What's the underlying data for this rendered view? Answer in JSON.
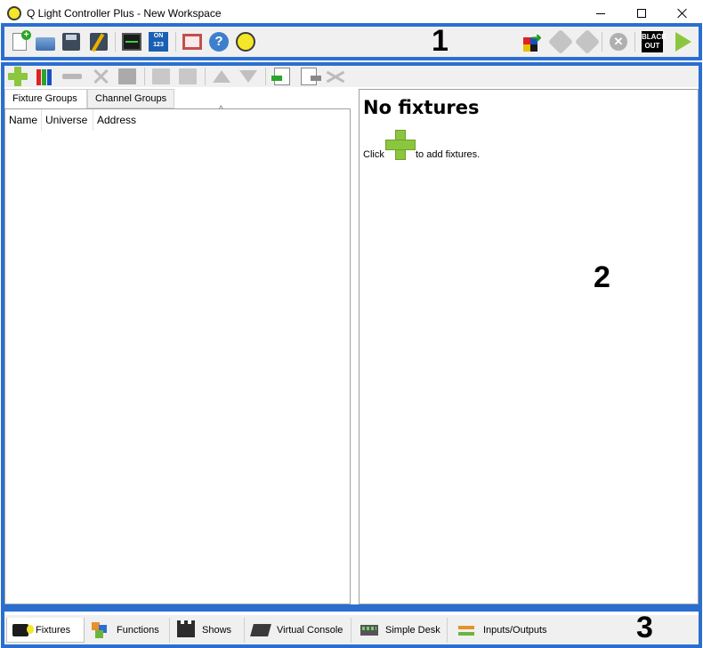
{
  "window": {
    "title": "Q Light Controller Plus - New Workspace",
    "minimize_symbol": "",
    "maximize_symbol": "",
    "close_symbol": ""
  },
  "annotations": {
    "area1": "1",
    "area2": "2",
    "area3": "3"
  },
  "colors": {
    "frame_blue": "#2a6fd0",
    "toolbar_bg": "#f0f0f0",
    "plus_green": "#8cc63f"
  },
  "main_toolbar": {
    "left_icons": [
      "new-workspace-icon",
      "open-workspace-icon",
      "save-workspace-icon",
      "save-as-icon",
      "dmx-monitor-icon",
      "address-tool-icon",
      "fullscreen-icon",
      "help-icon",
      "about-qlc-icon"
    ],
    "right_icons": [
      "add-fixture-wizard-icon",
      "live-edit-icon",
      "edit-icon",
      "stop-all-icon",
      "blackout-icon",
      "operate-mode-icon"
    ],
    "blackout_text": "BLACK OUT"
  },
  "fixture_toolbar": {
    "icons": [
      "add-fixture-icon",
      "add-rgb-panel-icon",
      "remove-fixture-icon",
      "properties-icon",
      "fade-config-icon",
      "group-icon",
      "ungroup-icon",
      "move-up-icon",
      "move-down-icon",
      "import-icon",
      "export-icon",
      "remap-icon"
    ]
  },
  "left_panel": {
    "tabs": [
      {
        "label": "Fixture Groups",
        "active": true
      },
      {
        "label": "Channel Groups",
        "active": false
      }
    ],
    "columns": [
      "Name",
      "Universe",
      "Address"
    ]
  },
  "right_panel": {
    "title": "No fixtures",
    "click_text": "Click",
    "after_text": "to add fixtures."
  },
  "bottom_tabs": [
    {
      "label": "Fixtures",
      "icon": "fixtures-icon",
      "active": true
    },
    {
      "label": "Functions",
      "icon": "functions-icon",
      "active": false
    },
    {
      "label": "Shows",
      "icon": "shows-icon",
      "active": false
    },
    {
      "label": "Virtual Console",
      "icon": "virtual-console-icon",
      "active": false
    },
    {
      "label": "Simple Desk",
      "icon": "simple-desk-icon",
      "active": false
    },
    {
      "label": "Inputs/Outputs",
      "icon": "inputs-outputs-icon",
      "active": false
    }
  ]
}
